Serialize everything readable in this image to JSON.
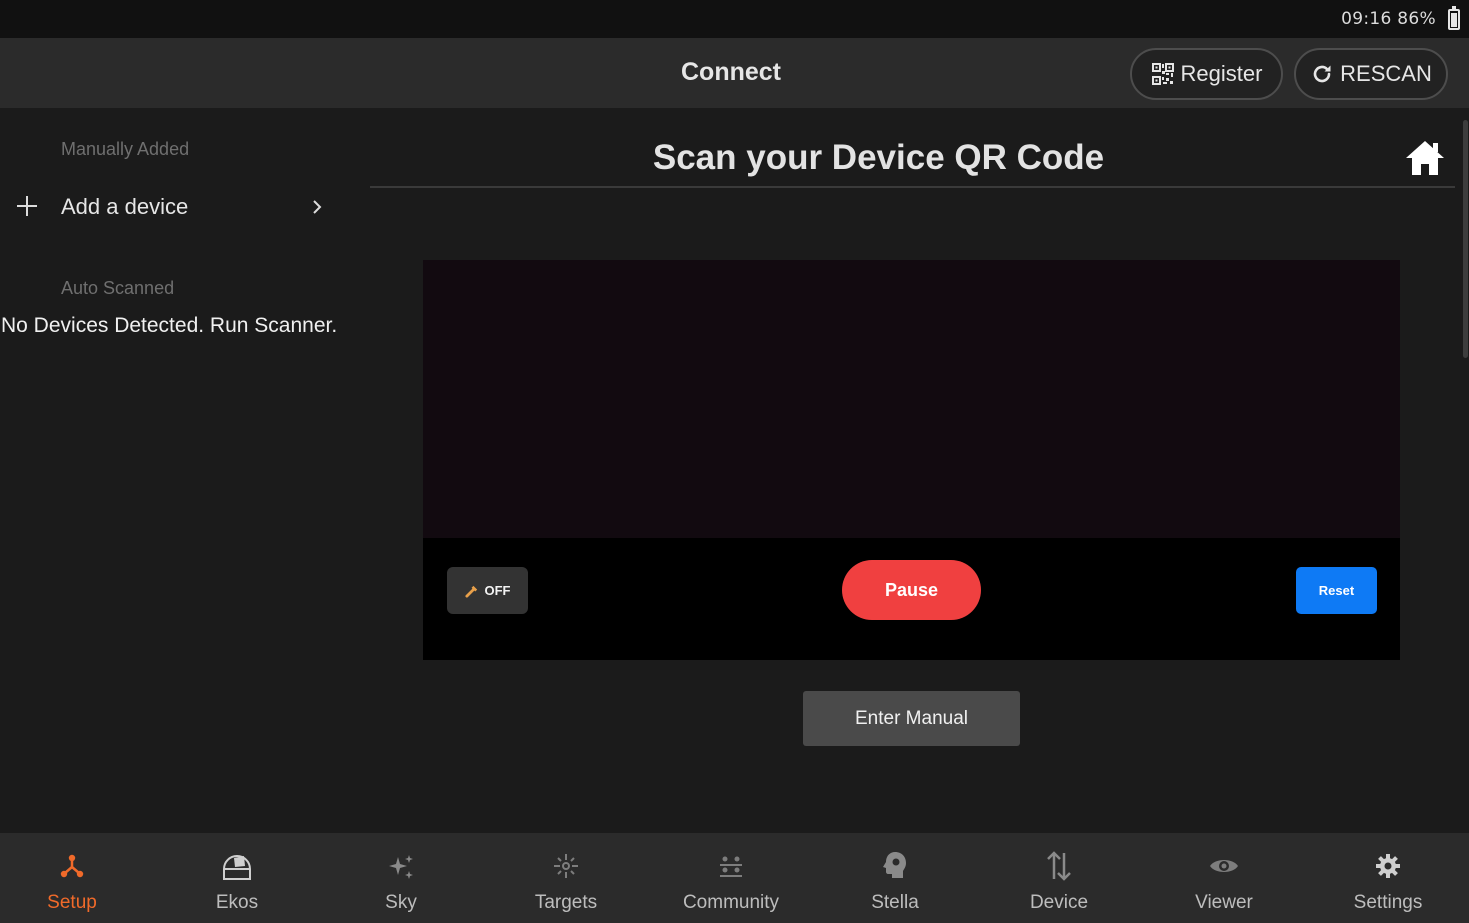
{
  "status_bar": {
    "time_battery": "09:16 86%"
  },
  "header": {
    "title": "Connect",
    "register_label": "Register",
    "rescan_label": "RESCAN"
  },
  "sidebar": {
    "manual_section": "Manually Added",
    "add_device": "Add a device",
    "auto_section": "Auto Scanned",
    "no_devices": "No Devices Detected. Run Scanner."
  },
  "main": {
    "title": "Scan your Device QR Code",
    "flash_label": "OFF",
    "pause_label": "Pause",
    "reset_label": "Reset",
    "enter_manual_label": "Enter Manual"
  },
  "nav": {
    "items": [
      {
        "label": "Setup",
        "icon": "setup-icon"
      },
      {
        "label": "Ekos",
        "icon": "ekos-icon"
      },
      {
        "label": "Sky",
        "icon": "sky-icon"
      },
      {
        "label": "Targets",
        "icon": "targets-icon"
      },
      {
        "label": "Community",
        "icon": "community-icon"
      },
      {
        "label": "Stella",
        "icon": "stella-icon"
      },
      {
        "label": "Device",
        "icon": "device-icon"
      },
      {
        "label": "Viewer",
        "icon": "viewer-icon"
      },
      {
        "label": "Settings",
        "icon": "settings-icon"
      }
    ],
    "active": "Setup"
  },
  "colors": {
    "accent": "#f06a2a",
    "pause": "#f04040",
    "reset": "#0e7af5",
    "background": "#1b1b1b",
    "bar": "#2b2b2b"
  }
}
